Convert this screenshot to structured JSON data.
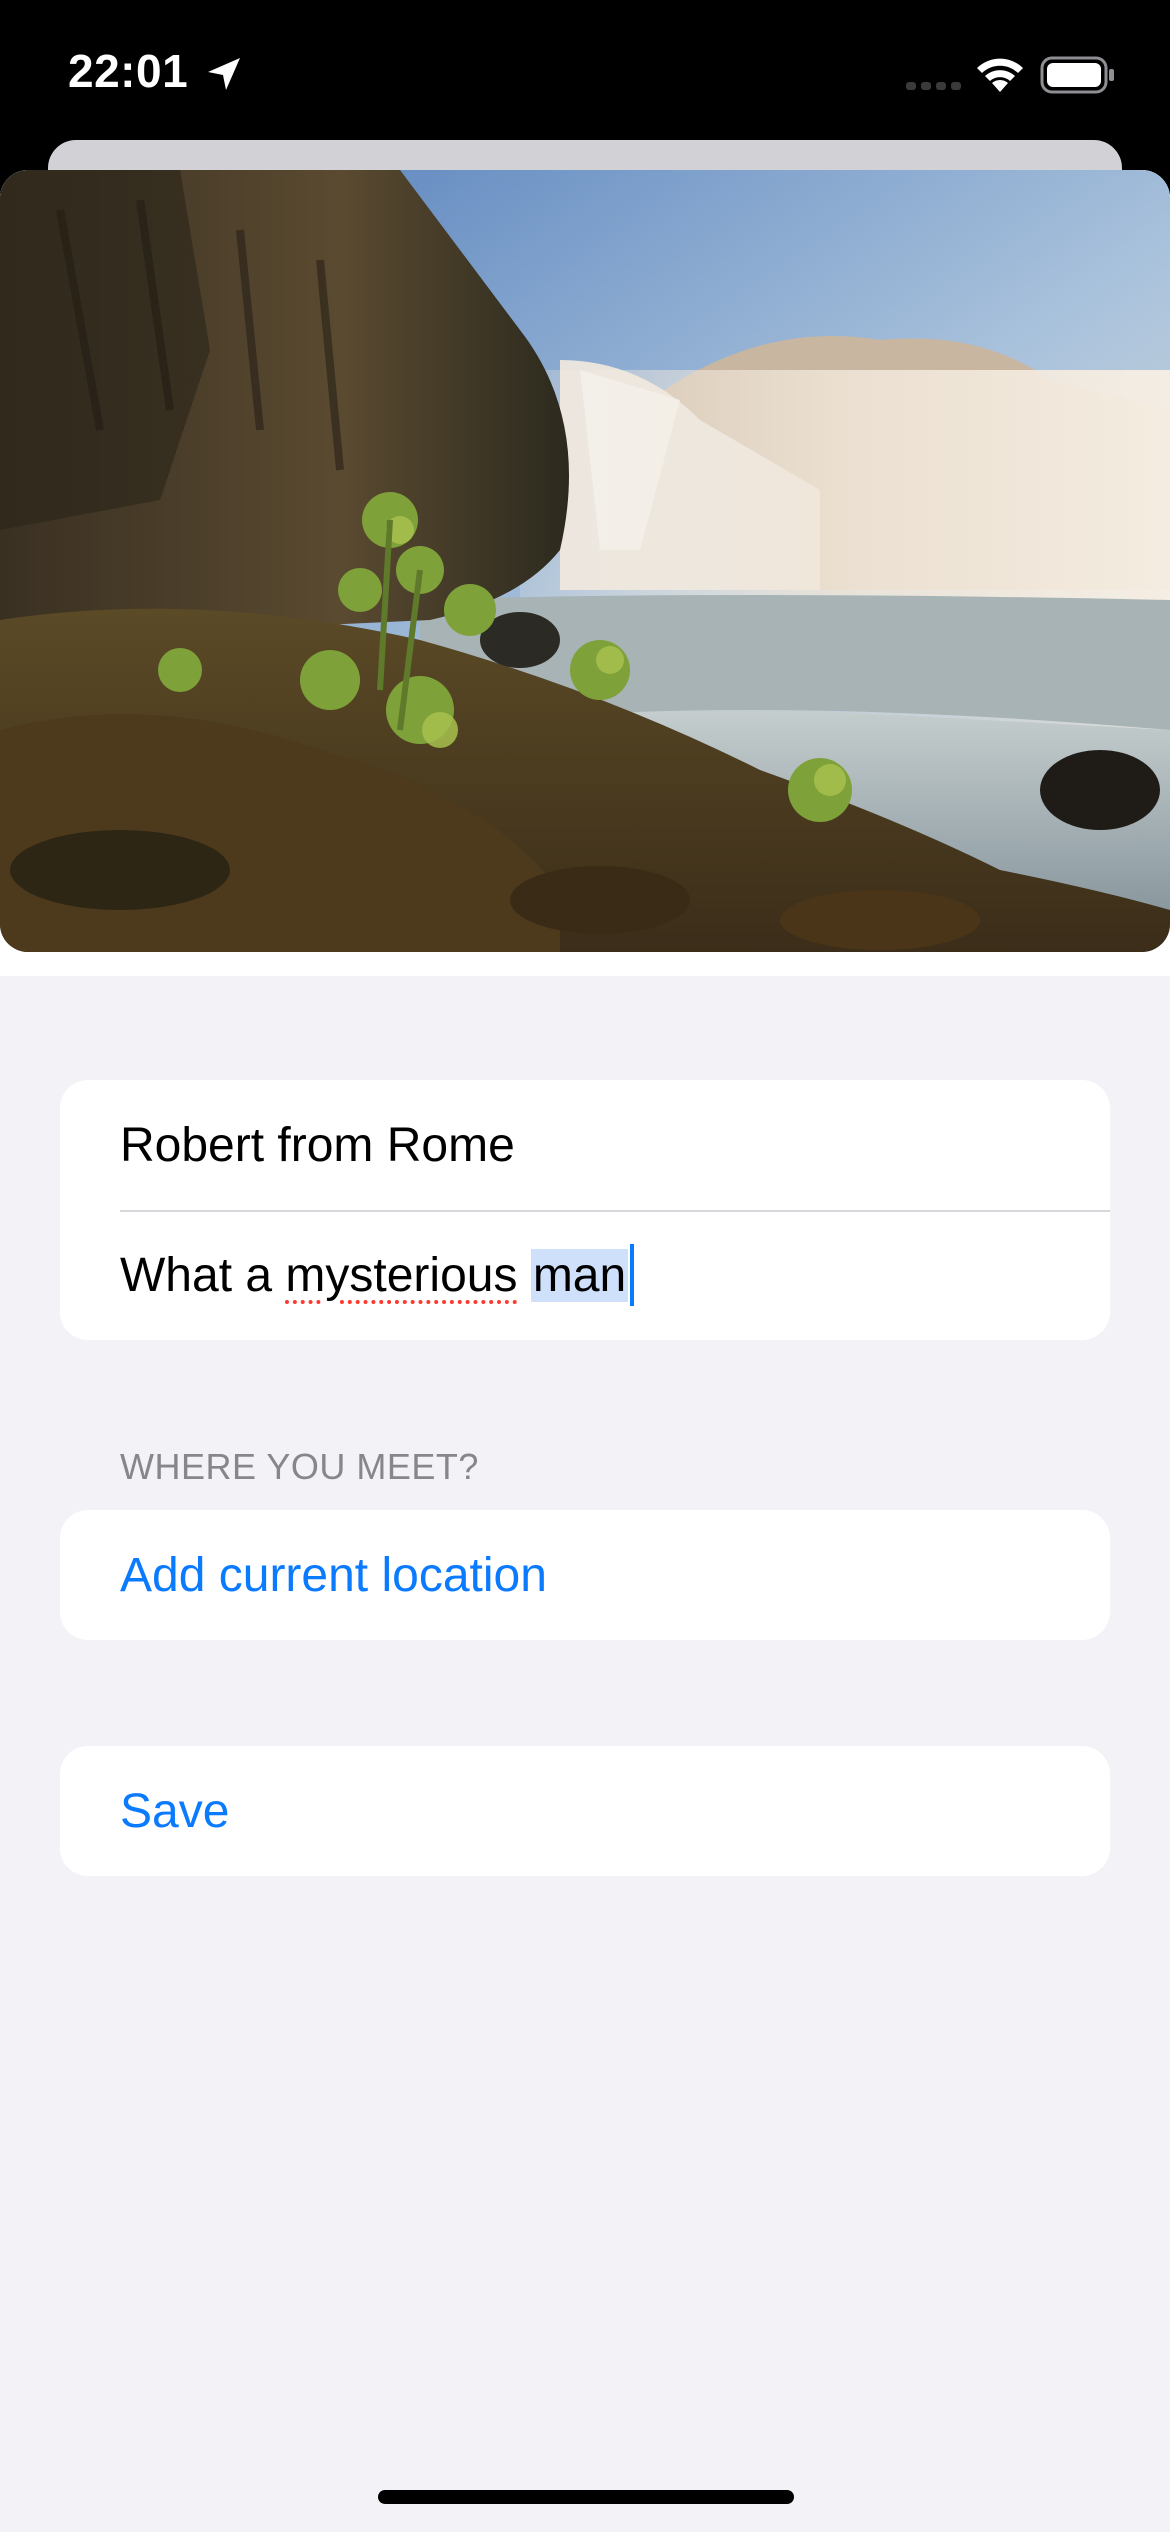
{
  "status_bar": {
    "time": "22:01"
  },
  "form": {
    "name_value": "Robert from Rome",
    "note_prefix": "What a ",
    "note_misspelled": "mysterious",
    "note_space": " ",
    "note_selected": "man",
    "location_section_header": "WHERE YOU MEET?",
    "add_location_label": "Add current location",
    "save_label": "Save"
  },
  "colors": {
    "accent": "#0a7aff",
    "background": "#f2f2f7",
    "spellcheck": "#ff3b30"
  },
  "icons": {
    "location": "location-arrow-icon",
    "wifi": "wifi-icon",
    "battery": "battery-icon",
    "signal": "cellular-signal-icon"
  }
}
